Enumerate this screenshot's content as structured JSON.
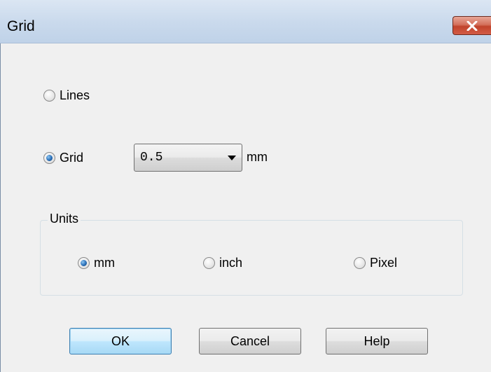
{
  "window": {
    "title": "Grid",
    "close_icon": "close-x-icon",
    "close_color": "#c1432c"
  },
  "style": {
    "radio_options": [
      "Lines",
      "Grid"
    ],
    "selected": "Grid",
    "lines_label": "Lines",
    "grid_label": "Grid"
  },
  "grid_size": {
    "value": "0.5",
    "unit": "mm"
  },
  "units": {
    "label": "Units",
    "options": [
      "mm",
      "inch",
      "Pixel"
    ],
    "selected": "mm",
    "mm_label": "mm",
    "inch_label": "inch",
    "pixel_label": "Pixel"
  },
  "buttons": {
    "ok": "OK",
    "cancel": "Cancel",
    "help": "Help"
  }
}
